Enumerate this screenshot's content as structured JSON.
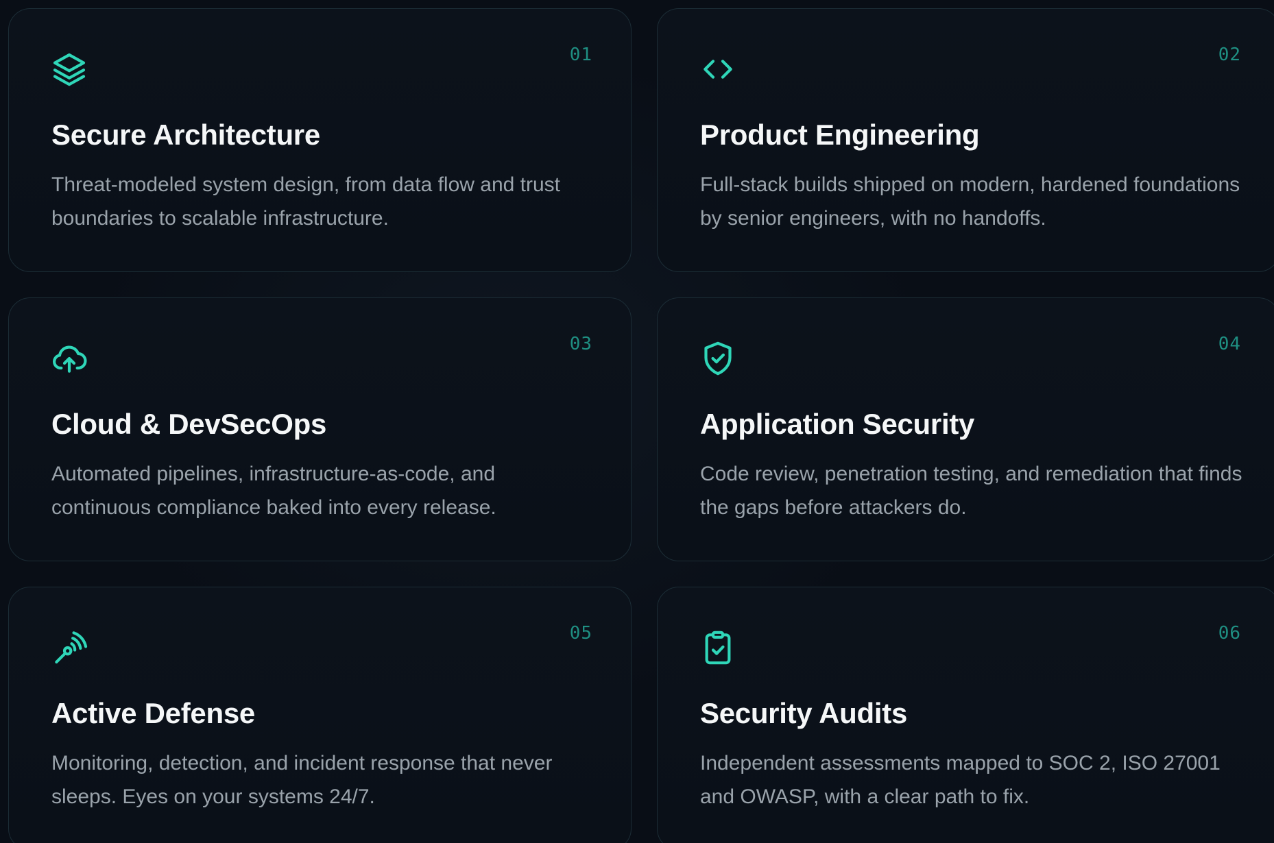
{
  "accent_color": "#2fd6b8",
  "cards": [
    {
      "number": "01",
      "icon": "layers-icon",
      "title": "Secure Architecture",
      "description": "Threat-modeled system design, from data flow and trust boundaries to scalable infrastructure."
    },
    {
      "number": "02",
      "icon": "code-icon",
      "title": "Product Engineering",
      "description": "Full-stack builds shipped on modern, hardened foundations by senior engineers, with no handoffs."
    },
    {
      "number": "03",
      "icon": "cloud-upload-icon",
      "title": "Cloud & DevSecOps",
      "description": "Automated pipelines, infrastructure-as-code, and continuous compliance baked into every release."
    },
    {
      "number": "04",
      "icon": "shield-check-icon",
      "title": "Application Security",
      "description": "Code review, penetration testing, and remediation that finds the gaps before attackers do."
    },
    {
      "number": "05",
      "icon": "radar-icon",
      "title": "Active Defense",
      "description": "Monitoring, detection, and incident response that never sleeps. Eyes on your systems 24/7."
    },
    {
      "number": "06",
      "icon": "clipboard-check-icon",
      "title": "Security Audits",
      "description": "Independent assessments mapped to SOC 2, ISO 27001 and OWASP, with a clear path to fix."
    }
  ]
}
